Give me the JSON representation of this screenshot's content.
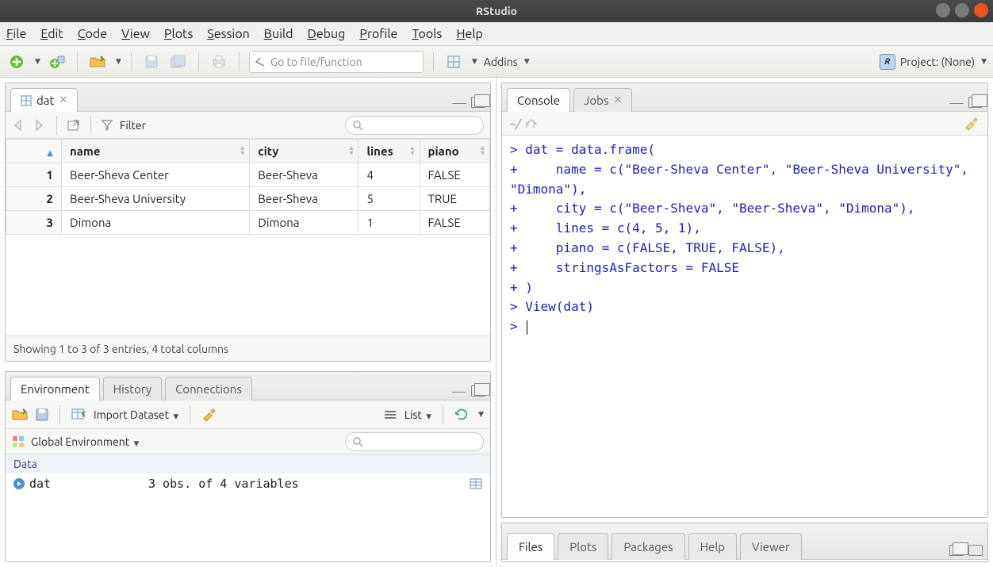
{
  "window_title": "RStudio",
  "menu": [
    "File",
    "Edit",
    "Code",
    "View",
    "Plots",
    "Session",
    "Build",
    "Debug",
    "Profile",
    "Tools",
    "Help"
  ],
  "toolbar": {
    "goto_placeholder": "Go to file/function",
    "addins_label": "Addins",
    "project_label": "Project: (None)"
  },
  "source_pane": {
    "tab_name": "dat",
    "filter_label": "Filter",
    "columns": [
      "name",
      "city",
      "lines",
      "piano"
    ],
    "rows": [
      {
        "n": 1,
        "name": "Beer-Sheva Center",
        "city": "Beer-Sheva",
        "lines": "4",
        "piano": "FALSE"
      },
      {
        "n": 2,
        "name": "Beer-Sheva University",
        "city": "Beer-Sheva",
        "lines": "5",
        "piano": "TRUE"
      },
      {
        "n": 3,
        "name": "Dimona",
        "city": "Dimona",
        "lines": "1",
        "piano": "FALSE"
      }
    ],
    "status": "Showing 1 to 3 of 3 entries, 4 total columns"
  },
  "env_pane": {
    "tabs": [
      "Environment",
      "History",
      "Connections"
    ],
    "import_label": "Import Dataset",
    "view_mode": "List",
    "scope_label": "Global Environment",
    "section": "Data",
    "items": [
      {
        "name": "dat",
        "desc": "3 obs. of  4 variables"
      }
    ]
  },
  "console_pane": {
    "tabs": [
      "Console",
      "Jobs"
    ],
    "wd": "~/",
    "lines": [
      "> dat = data.frame(",
      "+     name = c(\"Beer-Sheva Center\", \"Beer-Sheva University\", \"Dimona\"),",
      "+     city = c(\"Beer-Sheva\", \"Beer-Sheva\", \"Dimona\"),",
      "+     lines = c(4, 5, 1),",
      "+     piano = c(FALSE, TRUE, FALSE),",
      "+     stringsAsFactors = FALSE",
      "+ )",
      "> View(dat)",
      "> "
    ]
  },
  "files_pane": {
    "tabs": [
      "Files",
      "Plots",
      "Packages",
      "Help",
      "Viewer"
    ]
  }
}
